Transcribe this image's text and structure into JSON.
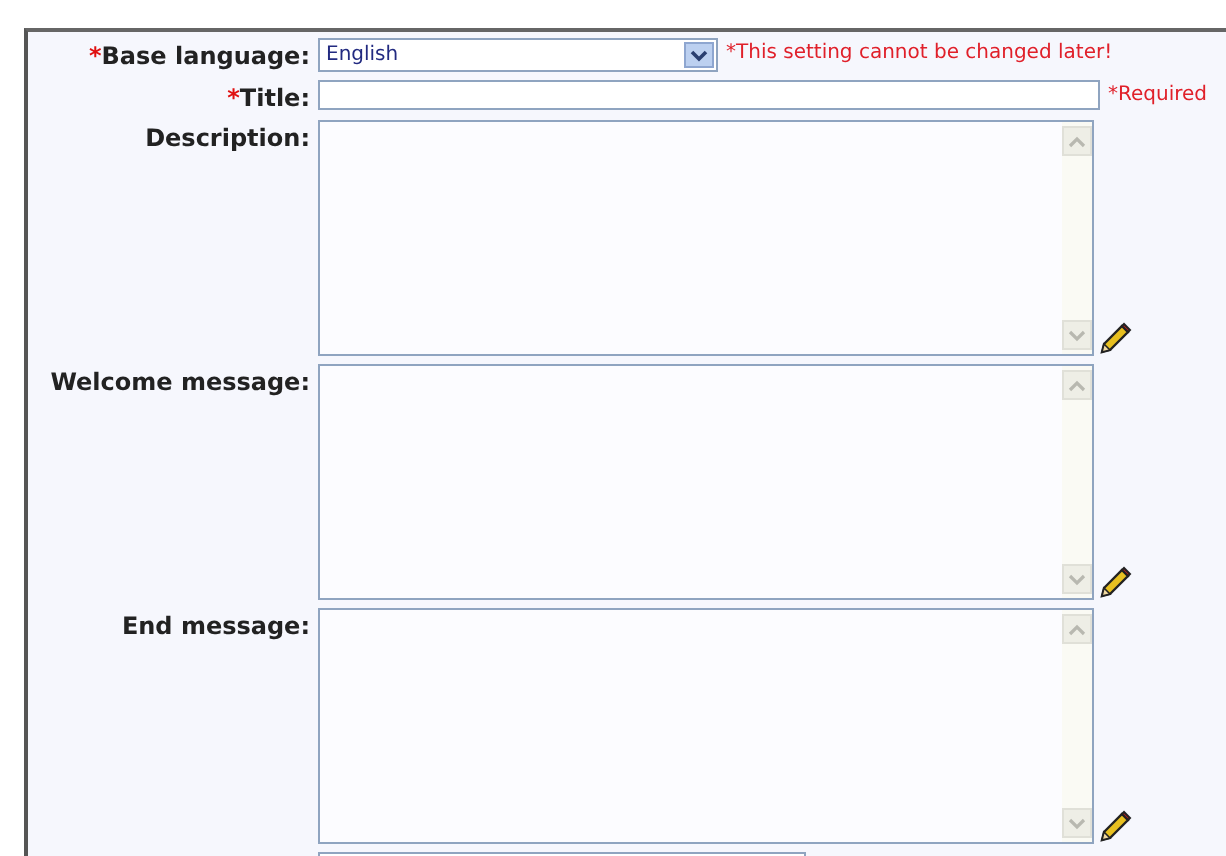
{
  "form": {
    "fields": [
      {
        "kind": "select",
        "marker": "*",
        "label": "Base language:",
        "value": "English",
        "note": "*This setting cannot be changed later!"
      },
      {
        "kind": "text",
        "marker": "*",
        "label": "Title:",
        "note": "*Required"
      },
      {
        "kind": "textarea",
        "label": "Description:"
      },
      {
        "kind": "textarea",
        "label": "Welcome message:"
      },
      {
        "kind": "textarea",
        "label": "End message:"
      },
      {
        "kind": "partial"
      }
    ]
  }
}
